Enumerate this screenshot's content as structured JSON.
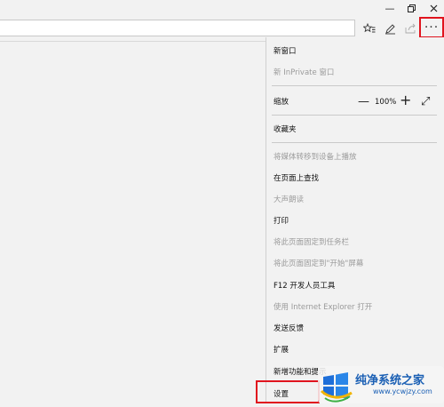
{
  "window": {
    "minimize_icon": "minimize-icon",
    "restore_icon": "restore-icon",
    "close_icon": "close-icon"
  },
  "toolbar": {
    "address_value": "",
    "favorites_icon": "star-list-icon",
    "notes_icon": "pen-icon",
    "share_icon": "share-icon",
    "more_label": "···"
  },
  "menu": {
    "new_window": "新窗口",
    "new_inprivate": "新 InPrivate 窗口",
    "zoom_label": "缩放",
    "zoom_minus": "—",
    "zoom_value": "100%",
    "zoom_plus": "+",
    "fullscreen_icon": "⤢",
    "favorites": "收藏夹",
    "cast_media": "将媒体转移到设备上播放",
    "find_on_page": "在页面上查找",
    "read_aloud": "大声朗读",
    "print": "打印",
    "pin_taskbar": "将此页面固定到任务栏",
    "pin_start": "将此页面固定到\"开始\"屏幕",
    "f12_tools": "F12 开发人员工具",
    "open_ie": "使用 Internet Explorer 打开",
    "send_feedback": "发送反馈",
    "extensions": "扩展",
    "whats_new": "新增功能和提示",
    "settings": "设置"
  },
  "watermark": {
    "title": "纯净系统之家",
    "url": "www.ycwjzy.com"
  },
  "colors": {
    "highlight": "#e0141e",
    "menu_bg": "#f2f2f2",
    "disabled_text": "#9a9a9a"
  }
}
